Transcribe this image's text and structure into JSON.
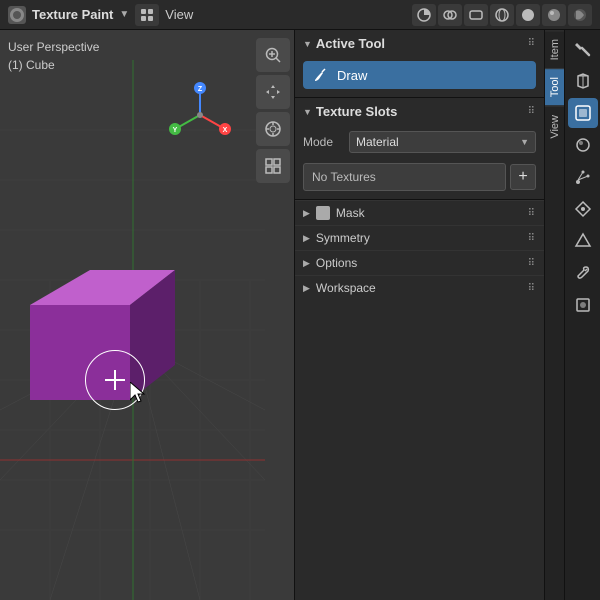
{
  "topbar": {
    "app_icon": "🎨",
    "mode_label": "Texture Paint",
    "mode_arrow": "▼",
    "view_label": "View",
    "icons": [
      "👁",
      "🔧",
      "🌐",
      "□",
      "◉",
      "◯",
      "▶"
    ]
  },
  "viewport": {
    "perspective_label": "User Perspective",
    "object_label": "(1) Cube"
  },
  "active_tool": {
    "header": "Active Tool",
    "draw_label": "Draw"
  },
  "texture_slots": {
    "header": "Texture Slots",
    "mode_label": "Mode",
    "mode_value": "Material",
    "no_textures_label": "No Textures",
    "add_label": "+"
  },
  "panel_sections": [
    {
      "label": "Mask",
      "has_icon": true
    },
    {
      "label": "Symmetry",
      "has_icon": false
    },
    {
      "label": "Options",
      "has_icon": false
    },
    {
      "label": "Workspace",
      "has_icon": false
    }
  ],
  "panel_tabs": [
    {
      "label": "Item",
      "active": false
    },
    {
      "label": "Tool",
      "active": true
    },
    {
      "label": "View",
      "active": false
    }
  ],
  "right_sidebar_icons": [
    {
      "name": "tools-icon",
      "symbol": "🔧"
    },
    {
      "name": "modifier-icon",
      "symbol": "🔩"
    },
    {
      "name": "material-icon",
      "symbol": "⬜"
    },
    {
      "name": "texture-paint-icon",
      "symbol": "🖼"
    },
    {
      "name": "particle-icon",
      "symbol": "✦"
    },
    {
      "name": "constraints-icon",
      "symbol": "⊕"
    },
    {
      "name": "object-data-icon",
      "symbol": "△"
    },
    {
      "name": "wrench-icon",
      "symbol": "🔨"
    },
    {
      "name": "object-props-icon",
      "symbol": "◇"
    }
  ],
  "colors": {
    "accent_blue": "#3a6fa0",
    "panel_bg": "#2a2a2a",
    "viewport_bg": "#3a3a3a",
    "cube_front": "#8b2f9a",
    "cube_top": "#b845c8",
    "cube_right": "#5c1f6a"
  }
}
